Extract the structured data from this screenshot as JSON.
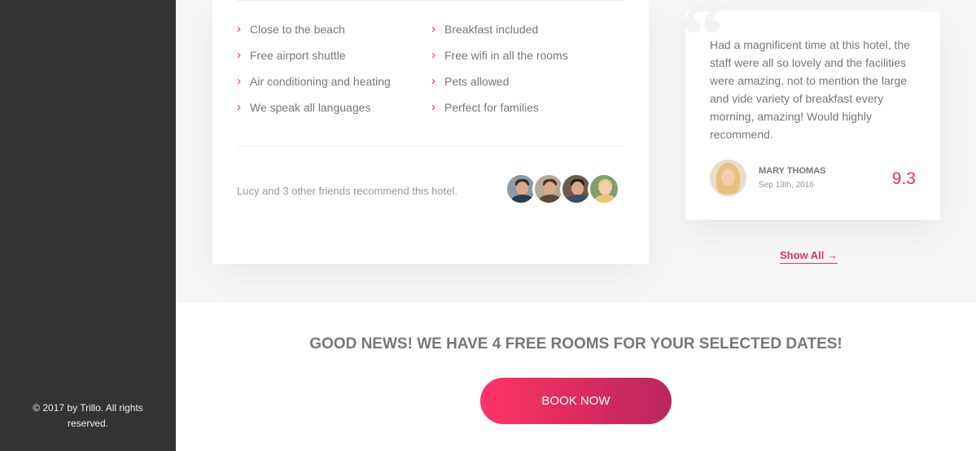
{
  "sidebar": {
    "copyright": "© 2017 by Trillo. All rights reserved."
  },
  "hotel": {
    "features": [
      {
        "label": "Close to the beach",
        "icon": "chevron-right-icon"
      },
      {
        "label": "Breakfast included",
        "icon": "chevron-right-icon"
      },
      {
        "label": "Free airport shuttle",
        "icon": "chevron-right-icon"
      },
      {
        "label": "Free wifi in all the rooms",
        "icon": "chevron-right-icon"
      },
      {
        "label": "Air conditioning and heating",
        "icon": "chevron-right-icon"
      },
      {
        "label": "Pets allowed",
        "icon": "chevron-right-icon"
      },
      {
        "label": "We speak all languages",
        "icon": "chevron-right-icon"
      },
      {
        "label": "Perfect for families",
        "icon": "chevron-right-icon"
      }
    ],
    "recommend": {
      "text": "Lucy and 3 other friends recommend this hotel."
    }
  },
  "review": {
    "text": "Had a magnificent time at this hotel, the staff were all so lovely and the facilities were amazing, not to mention the large and vide variety of breakfast every morning, amazing! Would highly recommend.",
    "name": "Mary Thomas",
    "date": "Sep 13th, 2016",
    "rating": "9.3"
  },
  "show_all": {
    "label": "Show All →"
  },
  "cta": {
    "heading": "GOOD NEWS! WE HAVE 4 FREE ROOMS FOR YOUR SELECTED DATES!",
    "button_label": "Book now"
  },
  "colors": {
    "accent": "#eb2f64",
    "gradient_start": "#ff3366",
    "gradient_end": "#ba265d",
    "sidebar_bg": "#333333"
  }
}
